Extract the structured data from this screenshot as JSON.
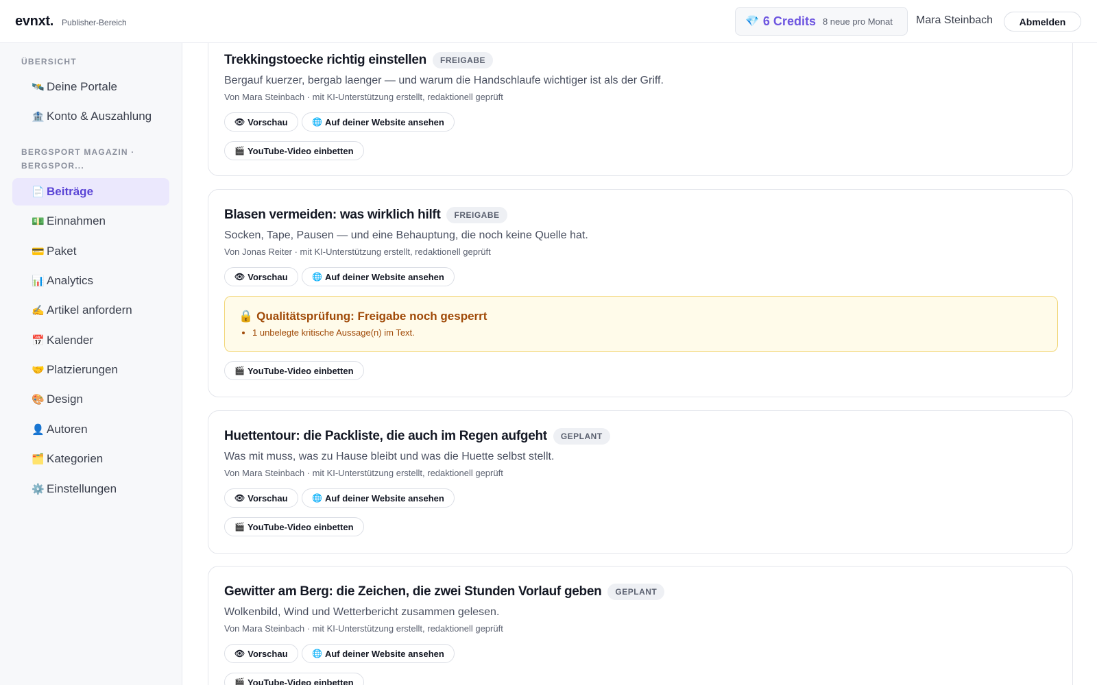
{
  "header": {
    "brand": "evnxt",
    "brand_dot": ".",
    "brand_sub": "Publisher-Bereich",
    "credits_icon": "gem-icon",
    "credits_value": "6 Credits",
    "credits_note": "8 neue pro Monat",
    "user_name": "Mara Steinbach",
    "logout_label": "Abmelden"
  },
  "sidebar": {
    "overview_label": "ÜBERSICHT",
    "overview_items": [
      {
        "icon": "🛰️",
        "label": "Deine Portale"
      },
      {
        "icon": "🏦",
        "label": "Konto & Auszahlung"
      }
    ],
    "portal_label_line1": "BERGSPORT MAGAZIN ·",
    "portal_label_line2": "BERGSPOR...",
    "portal_items": [
      {
        "icon": "📄",
        "label": "Beiträge",
        "active": true
      },
      {
        "icon": "💵",
        "label": "Einnahmen"
      },
      {
        "icon": "💳",
        "label": "Paket"
      },
      {
        "icon": "📊",
        "label": "Analytics"
      },
      {
        "icon": "✍️",
        "label": "Artikel anfordern"
      },
      {
        "icon": "📅",
        "label": "Kalender"
      },
      {
        "icon": "🤝",
        "label": "Platzierungen"
      },
      {
        "icon": "🎨",
        "label": "Design"
      },
      {
        "icon": "👤",
        "label": "Autoren"
      },
      {
        "icon": "🗂️",
        "label": "Kategorien"
      },
      {
        "icon": "⚙️",
        "label": "Einstellungen"
      }
    ]
  },
  "buttons": {
    "preview_icon": "👁",
    "preview_label": "Vorschau",
    "website_icon": "🌐",
    "website_label": "Auf deiner Website ansehen",
    "youtube_icon": "🎬",
    "youtube_label": "YouTube-Video einbetten"
  },
  "posts": [
    {
      "title": "Trekkingstoecke richtig einstellen",
      "status": "FREIGABE",
      "description": "Bergauf kuerzer, bergab laenger — und warum die Handschlaufe wichtiger ist als der Griff.",
      "meta": "Von Mara Steinbach · mit KI-Unterstützung erstellt, redaktionell geprüft"
    },
    {
      "title": "Blasen vermeiden: was wirklich hilft",
      "status": "FREIGABE",
      "description": "Socken, Tape, Pausen — und eine Behauptung, die noch keine Quelle hat.",
      "meta": "Von Jonas Reiter · mit KI-Unterstützung erstellt, redaktionell geprüft",
      "quality_check": {
        "icon": "🔒",
        "title": "Qualitätsprüfung: Freigabe noch gesperrt",
        "issues": [
          "1 unbelegte kritische Aussage(n) im Text."
        ]
      }
    },
    {
      "title": "Huettentour: die Packliste, die auch im Regen aufgeht",
      "status": "GEPLANT",
      "description": "Was mit muss, was zu Hause bleibt und was die Huette selbst stellt.",
      "meta": "Von Mara Steinbach · mit KI-Unterstützung erstellt, redaktionell geprüft"
    },
    {
      "title": "Gewitter am Berg: die Zeichen, die zwei Stunden Vorlauf geben",
      "status": "GEPLANT",
      "description": "Wolkenbild, Wind und Wetterbericht zusammen gelesen.",
      "meta": "Von Mara Steinbach · mit KI-Unterstützung erstellt, redaktionell geprüft"
    }
  ]
}
